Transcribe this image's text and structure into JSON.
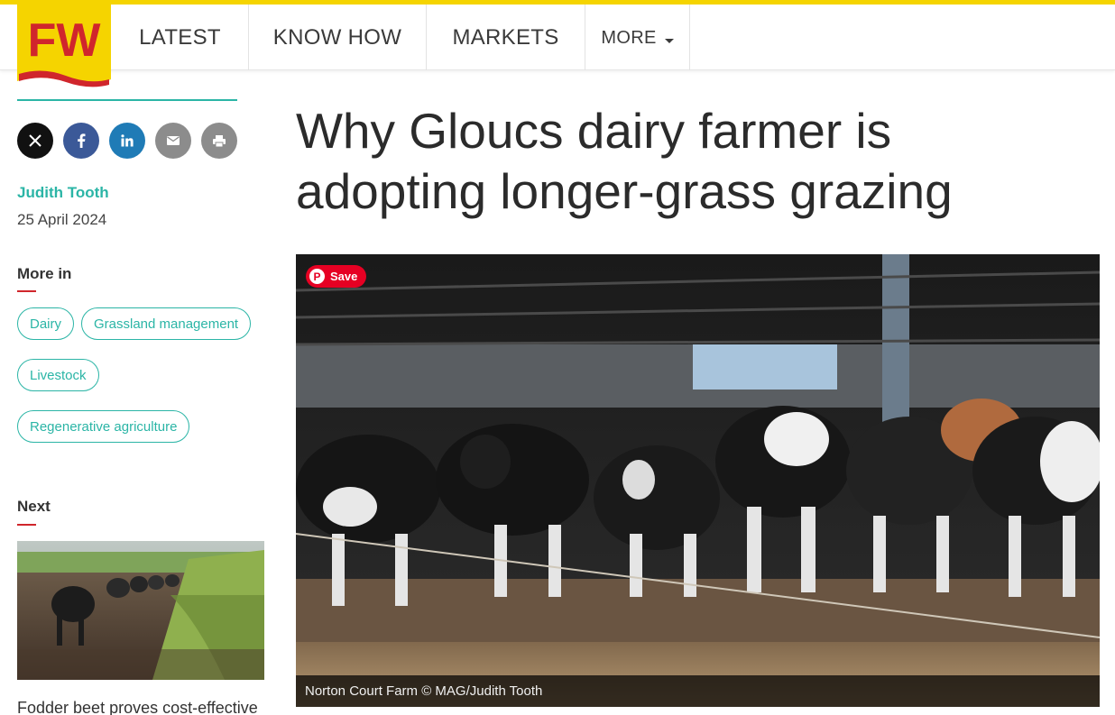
{
  "header": {
    "logo_text": "FW",
    "nav": [
      {
        "label": "LATEST"
      },
      {
        "label": "KNOW HOW"
      },
      {
        "label": "MARKETS"
      },
      {
        "label": "MORE"
      }
    ]
  },
  "colors": {
    "accent_teal": "#2bb5a6",
    "brand_yellow": "#f5d400",
    "brand_red": "#d0262c",
    "pinterest_red": "#e60023"
  },
  "share": [
    {
      "icon": "x-icon"
    },
    {
      "icon": "facebook-icon"
    },
    {
      "icon": "linkedin-icon"
    },
    {
      "icon": "email-icon"
    },
    {
      "icon": "print-icon"
    }
  ],
  "article": {
    "author": "Judith Tooth",
    "date": "25 April 2024",
    "headline": "Why Gloucs dairy farmer is adopting longer-grass grazing",
    "image_caption": "Norton Court Farm © MAG/Judith Tooth",
    "pin_label": "Save"
  },
  "more_in": {
    "heading": "More in",
    "tags": [
      "Dairy",
      "Grassland management",
      "Livestock",
      "Regenerative agriculture"
    ]
  },
  "next": {
    "heading": "Next",
    "title": "Fodder beet proves cost-effective"
  }
}
